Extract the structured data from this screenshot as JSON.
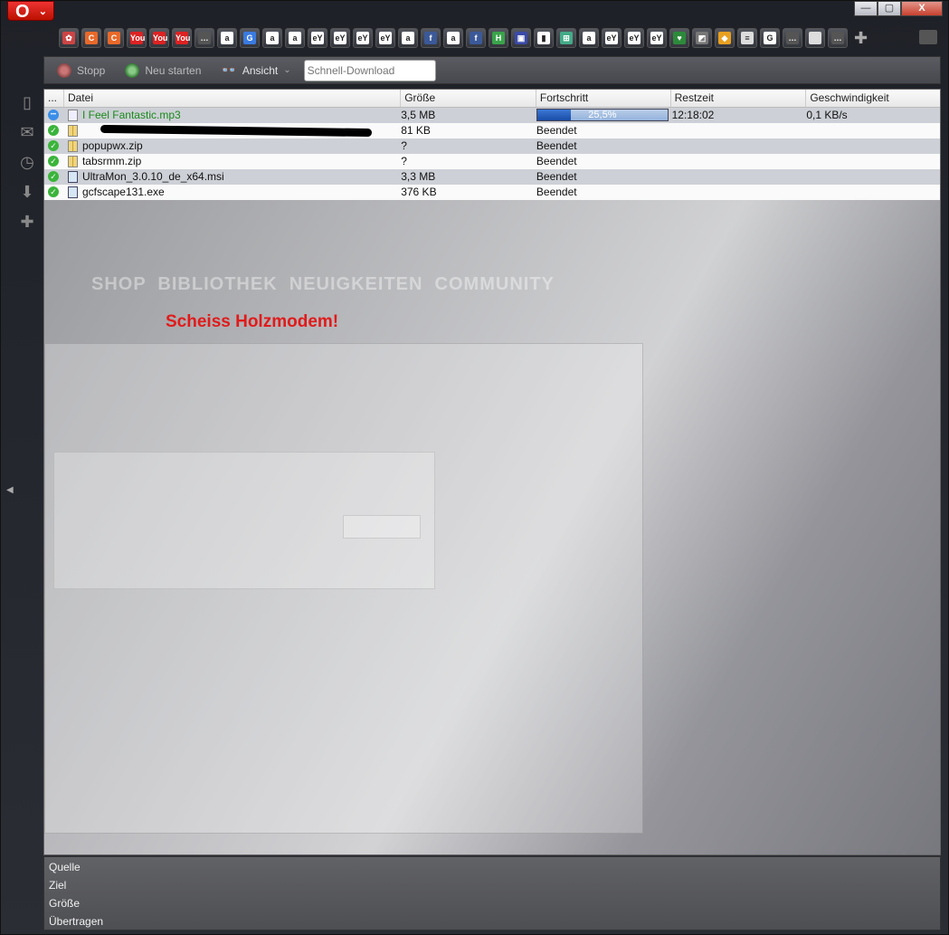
{
  "window": {
    "app_button": "O",
    "controls": [
      "—",
      "▢",
      "X"
    ]
  },
  "bookmarks": [
    {
      "icon": "flower-icon",
      "bg": "#c44",
      "label": "✿"
    },
    {
      "icon": "c-icon-1",
      "bg": "#e8692a",
      "label": "C"
    },
    {
      "icon": "c-icon-2",
      "bg": "#e8692a",
      "label": "C"
    },
    {
      "icon": "youtube-icon-1",
      "bg": "#d22",
      "label": "You"
    },
    {
      "icon": "youtube-icon-2",
      "bg": "#d22",
      "label": "You"
    },
    {
      "icon": "youtube-icon-3",
      "bg": "#d22",
      "label": "You"
    },
    {
      "icon": "more-icon-1",
      "bg": "#555",
      "label": "…"
    },
    {
      "icon": "amazon-icon-1",
      "bg": "#fff",
      "label": "a"
    },
    {
      "icon": "g-icon",
      "bg": "#3a7be0",
      "label": "G"
    },
    {
      "icon": "amazon-icon-2",
      "bg": "#fff",
      "label": "a"
    },
    {
      "icon": "amazon-icon-3",
      "bg": "#fff",
      "label": "a"
    },
    {
      "icon": "ebay-icon-1",
      "bg": "#fff",
      "label": "eY"
    },
    {
      "icon": "ebay-icon-2",
      "bg": "#fff",
      "label": "eY"
    },
    {
      "icon": "ebay-icon-3",
      "bg": "#fff",
      "label": "eY"
    },
    {
      "icon": "ebay-icon-4",
      "bg": "#fff",
      "label": "eY"
    },
    {
      "icon": "amazon-icon-4",
      "bg": "#fff",
      "label": "a"
    },
    {
      "icon": "facebook-icon-1",
      "bg": "#3b5998",
      "label": "f"
    },
    {
      "icon": "amazon-icon-5",
      "bg": "#fff",
      "label": "a"
    },
    {
      "icon": "facebook-icon-2",
      "bg": "#3b5998",
      "label": "f"
    },
    {
      "icon": "h-icon",
      "bg": "#3aa34a",
      "label": "H"
    },
    {
      "icon": "window-icon",
      "bg": "#3a4aa8",
      "label": "▣"
    },
    {
      "icon": "flag-icon",
      "bg": "#fff",
      "label": "▮"
    },
    {
      "icon": "windows-icon",
      "bg": "#4a8",
      "label": "⊞"
    },
    {
      "icon": "amazon-icon-6",
      "bg": "#fff",
      "label": "a"
    },
    {
      "icon": "ebay-icon-5",
      "bg": "#fff",
      "label": "eY"
    },
    {
      "icon": "ebay-icon-6",
      "bg": "#fff",
      "label": "eY"
    },
    {
      "icon": "ebay-icon-7",
      "bg": "#fff",
      "label": "eY"
    },
    {
      "icon": "shield-icon",
      "bg": "#2c8a3a",
      "label": "♥"
    },
    {
      "icon": "gradient-icon",
      "bg": "#777",
      "label": "◩"
    },
    {
      "icon": "tag-icon",
      "bg": "#e8a020",
      "label": "◆"
    },
    {
      "icon": "stripes-icon",
      "bg": "#ddd",
      "label": "≡"
    },
    {
      "icon": "google-icon",
      "bg": "#fff",
      "label": "G"
    },
    {
      "icon": "more-icon-2",
      "bg": "#555",
      "label": "…"
    },
    {
      "icon": "blank-icon",
      "bg": "#ddd",
      "label": ""
    },
    {
      "icon": "more-icon-3",
      "bg": "#555",
      "label": "…"
    }
  ],
  "toolbar": {
    "stop_label": "Stopp",
    "restart_label": "Neu starten",
    "view_label": "Ansicht",
    "quick_download_placeholder": "Schnell-Download"
  },
  "columns": [
    "...",
    "Datei",
    "Größe",
    "Fortschritt",
    "Restzeit",
    "Geschwindigkeit"
  ],
  "downloads": [
    {
      "name": "I Feel Fantastic.mp3",
      "size": "3,5 MB",
      "progress": "25,5%",
      "progress_value": 0.255,
      "remaining": "12:18:02",
      "speed": "0,1 KB/s",
      "status": "downloading",
      "type": "mp3"
    },
    {
      "name": "",
      "size": "81 KB",
      "progress": "Beendet",
      "remaining": "",
      "speed": "",
      "status": "done",
      "type": "zip"
    },
    {
      "name": "popupwx.zip",
      "size": "?",
      "progress": "Beendet",
      "remaining": "",
      "speed": "",
      "status": "done",
      "type": "zip"
    },
    {
      "name": "tabsrmm.zip",
      "size": "?",
      "progress": "Beendet",
      "remaining": "",
      "speed": "",
      "status": "done",
      "type": "zip"
    },
    {
      "name": "UltraMon_3.0.10_de_x64.msi",
      "size": "3,3 MB",
      "progress": "Beendet",
      "remaining": "",
      "speed": "",
      "status": "done",
      "type": "exe"
    },
    {
      "name": "gcfscape131.exe",
      "size": "376 KB",
      "progress": "Beendet",
      "remaining": "",
      "speed": "",
      "status": "done",
      "type": "exe"
    }
  ],
  "annotation": "Scheiss Holzmodem!",
  "details": {
    "source_label": "Quelle",
    "target_label": "Ziel",
    "size_label": "Größe",
    "transferred_label": "Übertragen"
  },
  "colors": {
    "accent_red": "#e01b1b",
    "progress_blue": "#1a4ca7",
    "done_green": "#3bb43b"
  }
}
